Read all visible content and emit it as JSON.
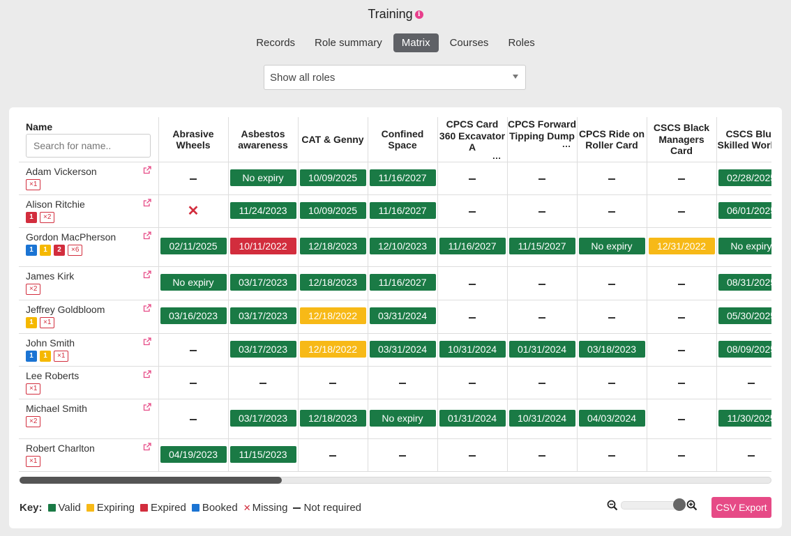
{
  "page": {
    "title": "Training",
    "info_icon": "info-icon"
  },
  "tabs": [
    {
      "label": "Records",
      "active": false
    },
    {
      "label": "Role summary",
      "active": false
    },
    {
      "label": "Matrix",
      "active": true
    },
    {
      "label": "Courses",
      "active": false
    },
    {
      "label": "Roles",
      "active": false
    }
  ],
  "role_filter": {
    "value": "Show all roles"
  },
  "table": {
    "name_header": "Name",
    "search_placeholder": "Search for name..",
    "columns": [
      {
        "label": "Abrasive Wheels",
        "truncated": false
      },
      {
        "label": "Asbestos awareness",
        "truncated": false
      },
      {
        "label": "CAT & Genny",
        "truncated": false
      },
      {
        "label": "Confined Space",
        "truncated": false
      },
      {
        "label": "CPCS Card 360 Excavator A",
        "truncated": true
      },
      {
        "label": "CPCS Forward Tipping Dump",
        "truncated": true
      },
      {
        "label": "CPCS Ride on Roller Card",
        "truncated": false
      },
      {
        "label": "CSCS Black Managers Card",
        "truncated": false
      },
      {
        "label": "CSCS Blue Skilled Worker",
        "truncated": false
      }
    ],
    "rows": [
      {
        "name": "Adam Vickerson",
        "badges": [
          {
            "type": "missing",
            "text": "×1"
          }
        ],
        "cells": [
          {
            "s": "none"
          },
          {
            "s": "valid",
            "t": "No expiry"
          },
          {
            "s": "valid",
            "t": "10/09/2025"
          },
          {
            "s": "valid",
            "t": "11/16/2027"
          },
          {
            "s": "none"
          },
          {
            "s": "none"
          },
          {
            "s": "none"
          },
          {
            "s": "none"
          },
          {
            "s": "valid",
            "t": "02/28/2025"
          }
        ]
      },
      {
        "name": "Alison Ritchie",
        "badges": [
          {
            "type": "expired",
            "text": "1"
          },
          {
            "type": "missing",
            "text": "×2"
          }
        ],
        "cells": [
          {
            "s": "missing"
          },
          {
            "s": "valid",
            "t": "11/24/2023"
          },
          {
            "s": "valid",
            "t": "10/09/2025"
          },
          {
            "s": "valid",
            "t": "11/16/2027"
          },
          {
            "s": "none"
          },
          {
            "s": "none"
          },
          {
            "s": "none"
          },
          {
            "s": "none"
          },
          {
            "s": "valid",
            "t": "06/01/2025"
          }
        ]
      },
      {
        "name": "Gordon MacPherson",
        "badges": [
          {
            "type": "booked",
            "text": "1"
          },
          {
            "type": "expiring",
            "text": "1"
          },
          {
            "type": "expired",
            "text": "2"
          },
          {
            "type": "missing",
            "text": "×6"
          }
        ],
        "cells": [
          {
            "s": "valid",
            "t": "02/11/2025"
          },
          {
            "s": "expired",
            "t": "10/11/2022"
          },
          {
            "s": "valid",
            "t": "12/18/2023"
          },
          {
            "s": "valid",
            "t": "12/10/2023"
          },
          {
            "s": "valid",
            "t": "11/16/2027"
          },
          {
            "s": "valid",
            "t": "11/15/2027"
          },
          {
            "s": "valid",
            "t": "No expiry"
          },
          {
            "s": "expiring",
            "t": "12/31/2022"
          },
          {
            "s": "valid",
            "t": "No expiry"
          }
        ]
      },
      {
        "name": "James Kirk",
        "badges": [
          {
            "type": "missing",
            "text": "×2"
          }
        ],
        "cells": [
          {
            "s": "valid",
            "t": "No expiry"
          },
          {
            "s": "valid",
            "t": "03/17/2023"
          },
          {
            "s": "valid",
            "t": "12/18/2023"
          },
          {
            "s": "valid",
            "t": "11/16/2027"
          },
          {
            "s": "none"
          },
          {
            "s": "none"
          },
          {
            "s": "none"
          },
          {
            "s": "none"
          },
          {
            "s": "valid",
            "t": "08/31/2025"
          }
        ]
      },
      {
        "name": "Jeffrey Goldbloom",
        "badges": [
          {
            "type": "expiring",
            "text": "1"
          },
          {
            "type": "missing",
            "text": "×1"
          }
        ],
        "cells": [
          {
            "s": "valid",
            "t": "03/16/2023"
          },
          {
            "s": "valid",
            "t": "03/17/2023"
          },
          {
            "s": "expiring",
            "t": "12/18/2022"
          },
          {
            "s": "valid",
            "t": "03/31/2024"
          },
          {
            "s": "none"
          },
          {
            "s": "none"
          },
          {
            "s": "none"
          },
          {
            "s": "none"
          },
          {
            "s": "valid",
            "t": "05/30/2025"
          }
        ]
      },
      {
        "name": "John Smith",
        "badges": [
          {
            "type": "booked",
            "text": "1"
          },
          {
            "type": "expiring",
            "text": "1"
          },
          {
            "type": "missing",
            "text": "×1"
          }
        ],
        "cells": [
          {
            "s": "none"
          },
          {
            "s": "valid",
            "t": "03/17/2023"
          },
          {
            "s": "expiring",
            "t": "12/18/2022"
          },
          {
            "s": "valid",
            "t": "03/31/2024"
          },
          {
            "s": "valid",
            "t": "10/31/2024"
          },
          {
            "s": "valid",
            "t": "01/31/2024"
          },
          {
            "s": "valid",
            "t": "03/18/2023"
          },
          {
            "s": "none"
          },
          {
            "s": "valid",
            "t": "08/09/2025"
          }
        ]
      },
      {
        "name": "Lee Roberts",
        "badges": [
          {
            "type": "missing",
            "text": "×1"
          }
        ],
        "cells": [
          {
            "s": "none"
          },
          {
            "s": "none"
          },
          {
            "s": "none"
          },
          {
            "s": "none"
          },
          {
            "s": "none"
          },
          {
            "s": "none"
          },
          {
            "s": "none"
          },
          {
            "s": "none"
          },
          {
            "s": "none"
          }
        ]
      },
      {
        "name": "Michael Smith",
        "badges": [
          {
            "type": "missing",
            "text": "×2"
          }
        ],
        "cells": [
          {
            "s": "none"
          },
          {
            "s": "valid",
            "t": "03/17/2023"
          },
          {
            "s": "valid",
            "t": "12/18/2023"
          },
          {
            "s": "valid",
            "t": "No expiry"
          },
          {
            "s": "valid",
            "t": "01/31/2024"
          },
          {
            "s": "valid",
            "t": "10/31/2024"
          },
          {
            "s": "valid",
            "t": "04/03/2024"
          },
          {
            "s": "none"
          },
          {
            "s": "valid",
            "t": "11/30/2025"
          }
        ]
      },
      {
        "name": "Robert Charlton",
        "badges": [
          {
            "type": "missing",
            "text": "×1"
          }
        ],
        "cells": [
          {
            "s": "valid",
            "t": "04/19/2023"
          },
          {
            "s": "valid",
            "t": "11/15/2023"
          },
          {
            "s": "none"
          },
          {
            "s": "none"
          },
          {
            "s": "none"
          },
          {
            "s": "none"
          },
          {
            "s": "none"
          },
          {
            "s": "none"
          },
          {
            "s": "none"
          }
        ]
      }
    ],
    "horizontal_scroll": 0.0
  },
  "key": {
    "title": "Key:",
    "items": [
      {
        "label": "Valid",
        "color": "#1a7a45",
        "kind": "square"
      },
      {
        "label": "Expiring",
        "color": "#f7b917",
        "kind": "square"
      },
      {
        "label": "Expired",
        "color": "#d22d3d",
        "kind": "square"
      },
      {
        "label": "Booked",
        "color": "#1b74d3",
        "kind": "square"
      },
      {
        "label": "Missing",
        "color": "#d22d3d",
        "kind": "cross"
      },
      {
        "label": "Not required",
        "color": "#333333",
        "kind": "dash"
      }
    ]
  },
  "zoom": {
    "level": 1.0
  },
  "export": {
    "label": "CSV Export"
  },
  "colors": {
    "accent": "#e64a86",
    "valid": "#1a7a45",
    "expiring": "#f7b917",
    "expired": "#d22d3d",
    "booked": "#1b74d3"
  }
}
